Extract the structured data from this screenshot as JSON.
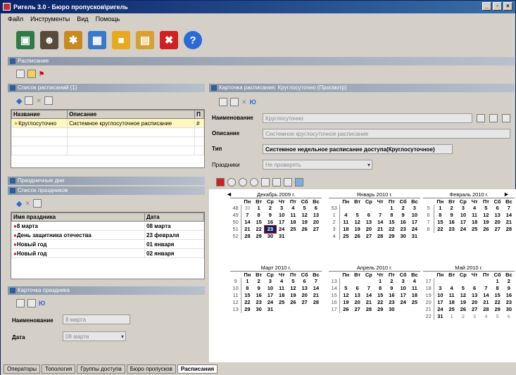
{
  "window": {
    "title": "Ригель 3.0 - Бюро пропусков\\ригель",
    "controls": [
      "_",
      "▫",
      "×"
    ]
  },
  "menu": [
    "Файл",
    "Инструменты",
    "Вид",
    "Помощь"
  ],
  "toolbar_icons": [
    {
      "name": "users-icon",
      "color": "#2f7a4a"
    },
    {
      "name": "person-icon",
      "color": "#5a4a3a"
    },
    {
      "name": "gear-icon",
      "color": "#c88a20"
    },
    {
      "name": "calendar-icon",
      "color": "#3a78c8"
    },
    {
      "name": "lock-icon",
      "color": "#e8a820"
    },
    {
      "name": "card-icon",
      "color": "#d8a030"
    },
    {
      "name": "delete-icon",
      "color": "#d02020"
    },
    {
      "name": "help-icon",
      "color": "#2a6ad8"
    }
  ],
  "schedule_section": "Расписание",
  "list_panel": {
    "title": "Список расписаний (1)",
    "columns": [
      "Название",
      "Описание",
      "П"
    ],
    "rows": [
      [
        "Круглосуточно",
        "Системное круглосуточное расписание",
        "#"
      ]
    ]
  },
  "holidays_section": "Праздничные дни",
  "holidays_list": {
    "title": "Список праздников",
    "columns": [
      "Имя праздника",
      "Дата"
    ],
    "rows": [
      [
        "8 марта",
        "08 марта"
      ],
      [
        "День защитника отечества",
        "23 февраля"
      ],
      [
        "Новый год",
        "01 января"
      ],
      [
        "Новый год",
        "02 января"
      ]
    ]
  },
  "holiday_card": {
    "title": "Карточка праздника",
    "name_label": "Наименование",
    "name_value": "8 марта",
    "date_label": "Дата",
    "date_value": "08 марта"
  },
  "schedule_card": {
    "title": "Карточка расписания: Круглосуточно (Просмотр)",
    "name_label": "Наименование",
    "name_value": "Круглосуточно",
    "desc_label": "Описание",
    "desc_value": "Системное круглосуточное расписание",
    "type_label": "Тип",
    "type_value": "Системное недельное расписание доступа(Круглосуточное)",
    "holidays_label": "Праздники",
    "holidays_value": "Не проверять"
  },
  "calendar": {
    "nav_prev": "◄",
    "nav_next": "►",
    "dow": [
      "Пн",
      "Вт",
      "Ср",
      "Чт",
      "Пт",
      "Сб",
      "Вс"
    ],
    "months": [
      {
        "title": "Декабрь 2009 г.",
        "weeks": [
          [
            "48",
            "30",
            "1",
            "2",
            "3",
            "4",
            "5",
            "6"
          ],
          [
            "49",
            "7",
            "8",
            "9",
            "10",
            "11",
            "12",
            "13"
          ],
          [
            "50",
            "14",
            "15",
            "16",
            "17",
            "18",
            "19",
            "20"
          ],
          [
            "51",
            "21",
            "22",
            "23",
            "24",
            "25",
            "26",
            "27"
          ],
          [
            "52",
            "28",
            "29",
            "30",
            "31",
            "",
            "",
            ""
          ]
        ]
      },
      {
        "title": "Январь 2010 г.",
        "weeks": [
          [
            "53",
            "",
            "",
            "",
            "",
            "1",
            "2",
            "3"
          ],
          [
            "1",
            "4",
            "5",
            "6",
            "7",
            "8",
            "9",
            "10"
          ],
          [
            "2",
            "11",
            "12",
            "13",
            "14",
            "15",
            "16",
            "17"
          ],
          [
            "3",
            "18",
            "19",
            "20",
            "21",
            "22",
            "23",
            "24"
          ],
          [
            "4",
            "25",
            "26",
            "27",
            "28",
            "29",
            "30",
            "31"
          ]
        ]
      },
      {
        "title": "Февраль 2010 г.",
        "weeks": [
          [
            "5",
            "1",
            "2",
            "3",
            "4",
            "5",
            "6",
            "7"
          ],
          [
            "6",
            "8",
            "9",
            "10",
            "11",
            "12",
            "13",
            "14"
          ],
          [
            "7",
            "15",
            "16",
            "17",
            "18",
            "19",
            "20",
            "21"
          ],
          [
            "8",
            "22",
            "23",
            "24",
            "25",
            "26",
            "27",
            "28"
          ]
        ]
      },
      {
        "title": "Март 2010 г.",
        "weeks": [
          [
            "9",
            "1",
            "2",
            "3",
            "4",
            "5",
            "6",
            "7"
          ],
          [
            "10",
            "8",
            "9",
            "10",
            "11",
            "12",
            "13",
            "14"
          ],
          [
            "11",
            "15",
            "16",
            "17",
            "18",
            "19",
            "20",
            "21"
          ],
          [
            "12",
            "22",
            "23",
            "24",
            "25",
            "26",
            "27",
            "28"
          ],
          [
            "13",
            "29",
            "30",
            "31",
            "",
            "",
            "",
            ""
          ]
        ]
      },
      {
        "title": "Апрель 2010 г.",
        "weeks": [
          [
            "13",
            "",
            "",
            "",
            "1",
            "2",
            "3",
            "4"
          ],
          [
            "14",
            "5",
            "6",
            "7",
            "8",
            "9",
            "10",
            "11"
          ],
          [
            "15",
            "12",
            "13",
            "14",
            "15",
            "16",
            "17",
            "18"
          ],
          [
            "16",
            "19",
            "20",
            "21",
            "22",
            "23",
            "24",
            "25"
          ],
          [
            "17",
            "26",
            "27",
            "28",
            "29",
            "30",
            "",
            ""
          ]
        ]
      },
      {
        "title": "Май 2010 г.",
        "weeks": [
          [
            "17",
            "",
            "",
            "",
            "",
            "",
            "1",
            "2"
          ],
          [
            "18",
            "3",
            "4",
            "5",
            "6",
            "7",
            "8",
            "9"
          ],
          [
            "19",
            "10",
            "11",
            "12",
            "13",
            "14",
            "15",
            "16"
          ],
          [
            "20",
            "17",
            "18",
            "19",
            "20",
            "21",
            "22",
            "23"
          ],
          [
            "21",
            "24",
            "25",
            "26",
            "27",
            "28",
            "29",
            "30"
          ],
          [
            "22",
            "31",
            "1",
            "2",
            "3",
            "4",
            "5",
            "6"
          ]
        ]
      }
    ],
    "today": "23"
  },
  "taskbar": [
    "Операторы",
    "Топология",
    "Группы доступа",
    "Бюро пропусков",
    "Расписания"
  ]
}
